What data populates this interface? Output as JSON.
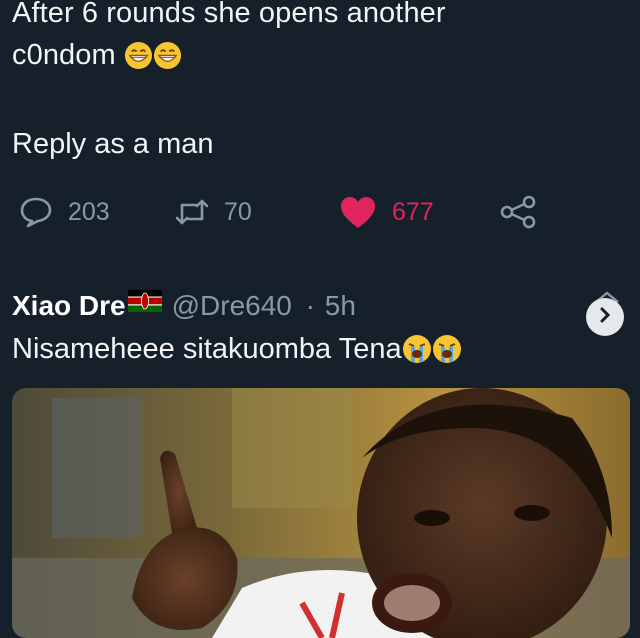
{
  "tweet": {
    "line1": "After 6 rounds she opens another",
    "line2": "c0ndom",
    "reply_prompt": "Reply as a man"
  },
  "actions": {
    "replies": "203",
    "retweets": "70",
    "likes": "677"
  },
  "reply": {
    "name": "Xiao Dre",
    "handle": "@Dre640",
    "separator": "·",
    "time": "5h",
    "text": "Nisameheee sitakuomba Tena"
  },
  "icons": {
    "reply": "comment-bubble-icon",
    "retweet": "retweet-icon",
    "like": "heart-icon",
    "share": "share-icon",
    "grin_emoji": "grinning-face-icon",
    "cry_emoji": "loudly-crying-face-icon",
    "flag": "kenya-flag-icon",
    "more": "chevron-right-icon"
  },
  "colors": {
    "background": "#15202b",
    "text": "#f2f4f6",
    "muted": "#8899a6",
    "like": "#e0245e"
  }
}
